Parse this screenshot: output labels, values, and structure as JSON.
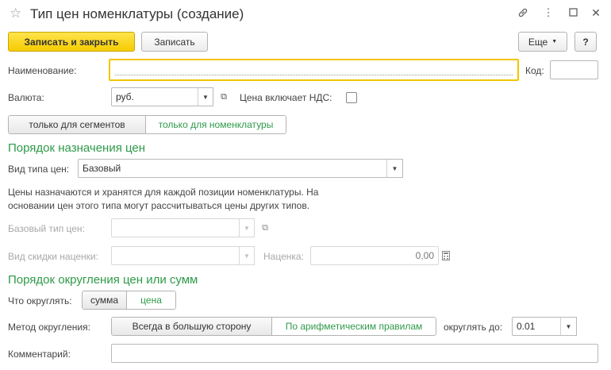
{
  "window": {
    "title": "Тип цен номенклатуры (создание)",
    "icons": {
      "star": "star-icon",
      "link": "link-icon",
      "more": "more-icon",
      "maximize": "maximize-icon",
      "close": "close-icon"
    }
  },
  "toolbar": {
    "save_close_label": "Записать и закрыть",
    "save_label": "Записать",
    "more_label": "Еще",
    "help_label": "?"
  },
  "form": {
    "name_label": "Наименование:",
    "name_value": "",
    "code_label": "Код:",
    "code_value": "",
    "currency_label": "Валюта:",
    "currency_value": "руб.",
    "vat_label": "Цена включает НДС:",
    "vat_checked": false,
    "mode_tabs": [
      "только для сегментов",
      "только для номенклатуры"
    ],
    "mode_selected": "только для номенклатуры",
    "section_pricing": "Порядок назначения цен",
    "price_kind_label": "Вид типа цен:",
    "price_kind_value": "Базовый",
    "info_line1": "Цены назначаются и хранятся для каждой позиции номенклатуры. На",
    "info_line2": "основании цен этого типа могут рассчитываться цены других типов.",
    "base_type_label": "Базовый тип цен:",
    "base_type_value": "",
    "markup_kind_label": "Вид скидки наценки:",
    "markup_kind_value": "",
    "markup_label": "Наценка:",
    "markup_value": "0,00",
    "section_rounding": "Порядок округления цен или сумм",
    "round_what_label": "Что округлять:",
    "round_what_options": [
      "сумма",
      "цена"
    ],
    "round_what_selected": "цена",
    "round_method_label": "Метод округления:",
    "round_method_options": [
      "Всегда в большую сторону",
      "По арифметическим правилам"
    ],
    "round_method_selected": "По арифметическим правилам",
    "round_to_label": "округлять до:",
    "round_to_value": "0.01",
    "comment_label": "Комментарий:",
    "comment_value": ""
  },
  "colors": {
    "accent_green": "#2e9a49",
    "primary_yellow": "#f5cb00",
    "focus_yellow": "#f2c500"
  }
}
